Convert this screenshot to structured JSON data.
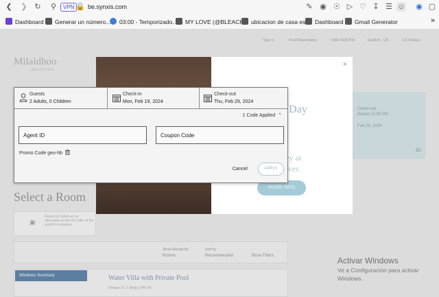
{
  "browser": {
    "vpn_label": "VPN",
    "url": "be.synxis.com",
    "icons": [
      "back-icon",
      "forward-icon",
      "reload-icon",
      "location-icon",
      "lock-icon",
      "share-icon",
      "camera-icon",
      "shield-icon",
      "send-icon",
      "heart-icon",
      "download-icon",
      "menu-icon",
      "profile-icon",
      "translate-icon",
      "cube-icon"
    ]
  },
  "bookmarks": {
    "items": [
      {
        "label": "Dashboard"
      },
      {
        "label": "Generar un número..."
      },
      {
        "label": "03:00 - Temporizado..."
      },
      {
        "label": "MY LOVE (@BLEACH..."
      },
      {
        "label": "ubicacion de casa es..."
      },
      {
        "label": "Dashboard"
      },
      {
        "label": "Gmail Generator"
      }
    ],
    "more": "»"
  },
  "background": {
    "logo": "Milaidhoo",
    "logo_sub": "MALDIVES",
    "nav": [
      "Sign in",
      "Find Reservation",
      "+960 6620750",
      "English · US",
      "US Dollars"
    ],
    "select_room": "Select a Room",
    "side_card": {
      "checkout_label": "Check-out",
      "checkout_time": "Before 12:00 PM",
      "checkout_date": "Feb 29, 2024",
      "total": "$0"
    },
    "banner_text": "Rooms & Suites as an alternative to the rich offer of the world for romance",
    "filters": {
      "sort_by_label": "Show Results By",
      "sort_by_value": "Rooms",
      "sort_label": "Sort by",
      "sort_value": "Recommended",
      "show_filters": "Show Filters"
    },
    "listing_head": "Windows Summary",
    "listing_title": "Water Villa with Private Pool",
    "listing_sub": "Sleeps 3  |  1 King  |  245 m²"
  },
  "promo": {
    "title": "'s Day",
    "line1": "dyssey at",
    "line2": "Maldives",
    "button": "MORE INFO",
    "close": "×"
  },
  "panel": {
    "guests_label": "Guests",
    "guests_value": "2 Adults, 0 Children",
    "checkin_label": "Check-in",
    "checkin_value": "Mon, Feb 19, 2024",
    "checkout_label": "Check-out",
    "checkout_value": "Thu, Feb 29, 2024",
    "codes_applied": "1 Code Applied",
    "agent_placeholder": "Agent ID",
    "coupon_placeholder": "Coupon Code",
    "promo_code": "Promo Code geo-hb",
    "cancel": "Cancel",
    "apply": "APPLY"
  },
  "windows": {
    "title": "Activar Windows",
    "text": "Ve a Configuración para activar Windows."
  }
}
